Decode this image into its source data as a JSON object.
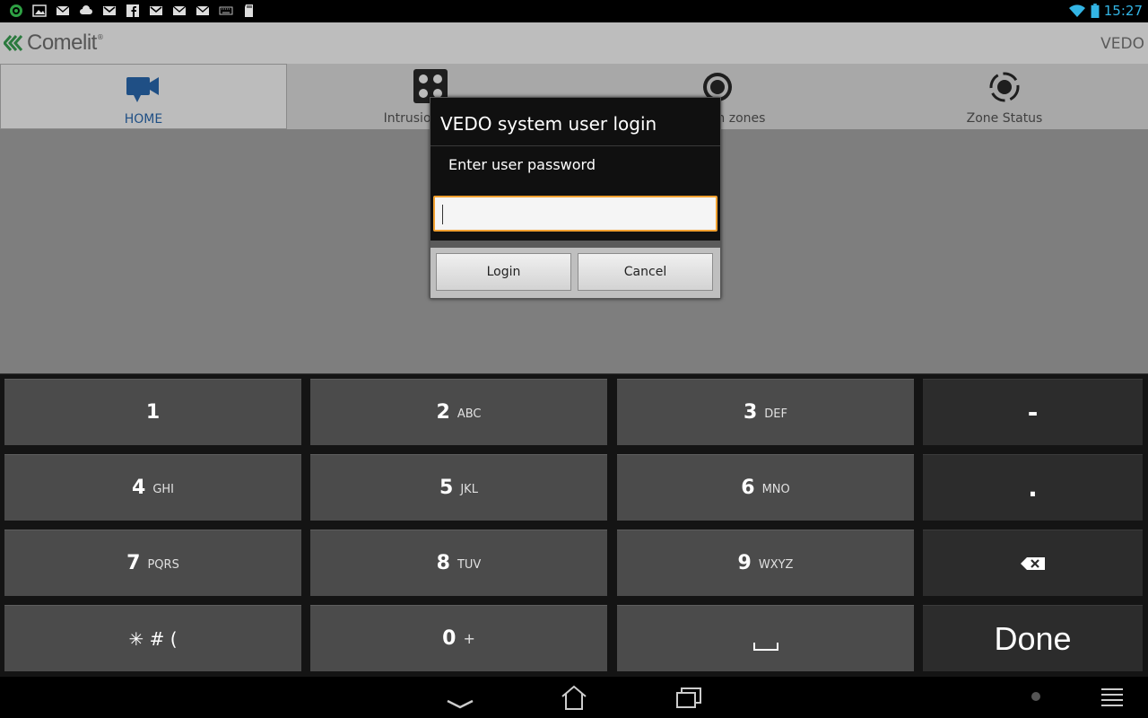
{
  "statusbar": {
    "time": "15:27",
    "icons": [
      "app-status-icon",
      "gallery-icon",
      "mail-icon",
      "cloud-icon",
      "gmail-icon",
      "facebook-icon",
      "gmail-icon",
      "mail-icon",
      "mail-icon",
      "keyboard-icon",
      "sd-card-icon",
      "wifi-icon",
      "battery-icon"
    ],
    "accent_color": "#33b5e5"
  },
  "header": {
    "brand": "Comelit",
    "brand_mark": "®",
    "app_title": "VEDO"
  },
  "tabs": [
    {
      "label": "HOME",
      "icon": "video-camera-icon",
      "active": true
    },
    {
      "label": "Intrusion areas",
      "icon": "keypad-icon",
      "active": false
    },
    {
      "label": "Intrusion zones",
      "icon": "target-icon",
      "active": false
    },
    {
      "label": "Zone Status",
      "icon": "zone-status-icon",
      "active": false
    }
  ],
  "dialog": {
    "title": "VEDO system user login",
    "message": "Enter user password",
    "password_value": "",
    "login_label": "Login",
    "cancel_label": "Cancel",
    "focus_color": "#f0a030"
  },
  "keyboard": {
    "keys": [
      {
        "digit": "1",
        "letters": ""
      },
      {
        "digit": "2",
        "letters": "ABC"
      },
      {
        "digit": "3",
        "letters": "DEF"
      },
      {
        "digit": "4",
        "letters": "GHI"
      },
      {
        "digit": "5",
        "letters": "JKL"
      },
      {
        "digit": "6",
        "letters": "MNO"
      },
      {
        "digit": "7",
        "letters": "PQRS"
      },
      {
        "digit": "8",
        "letters": "TUV"
      },
      {
        "digit": "9",
        "letters": "WXYZ"
      },
      {
        "digit": "0",
        "letters": "+"
      }
    ],
    "symbols_label": "✳ # (",
    "minus_label": "-",
    "period_label": ".",
    "done_label": "Done"
  },
  "navbar": {
    "icons": [
      "hide-keyboard-icon",
      "home-icon",
      "recent-apps-icon",
      "dot-icon",
      "menu-icon"
    ]
  }
}
